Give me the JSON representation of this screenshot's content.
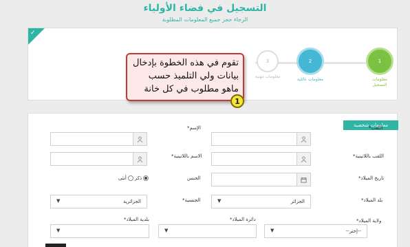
{
  "header": {
    "title": "التسجيل في فضاء الأولياء",
    "subtitle": "الرجاء حجز جميع المعلومات المطلوبة"
  },
  "steps": [
    {
      "number": "1",
      "label_line1": "معلومات",
      "label_line2": "التسجيل",
      "color": "#7cc242"
    },
    {
      "number": "2",
      "label_line1": "معلومات عائلية",
      "label_line2": "",
      "color": "#45b6d3"
    },
    {
      "number": "3",
      "label_line1": "معلومات مهنية",
      "label_line2": "",
      "color": "#d6d6d6"
    }
  ],
  "callout": {
    "line1": "تقوم في هذه الخطوة بإدخال",
    "line2": "بيانات ولي التلميذ حسب",
    "line3": "ماهو مطلوب في كل خانة",
    "marker": "1"
  },
  "form": {
    "section_title": "معلومات شخصية",
    "labels": {
      "surname": "اللقب*",
      "name": "الإسم*",
      "surname_latin": "اللقب باللاتينية*",
      "name_latin": "الاسم باللاتينية*",
      "birth_date": "تاريخ الميلاد*",
      "gender": "الجنس",
      "birth_country": "بلد الميلاد*",
      "nationality": "الجنسية*",
      "birth_wilaya": "ولاية الميلاد*",
      "birth_daira": "دائرة الميلاد*",
      "birth_commune": "بلدية الميلاد*"
    },
    "gender_options": {
      "male": "ذكر",
      "female": "أنثى"
    },
    "birth_country_value": "الجزائر",
    "nationality_value": "الجزائرية",
    "wilaya_placeholder": "--إختر--"
  },
  "colors": {
    "accent": "#2fb5a4"
  }
}
